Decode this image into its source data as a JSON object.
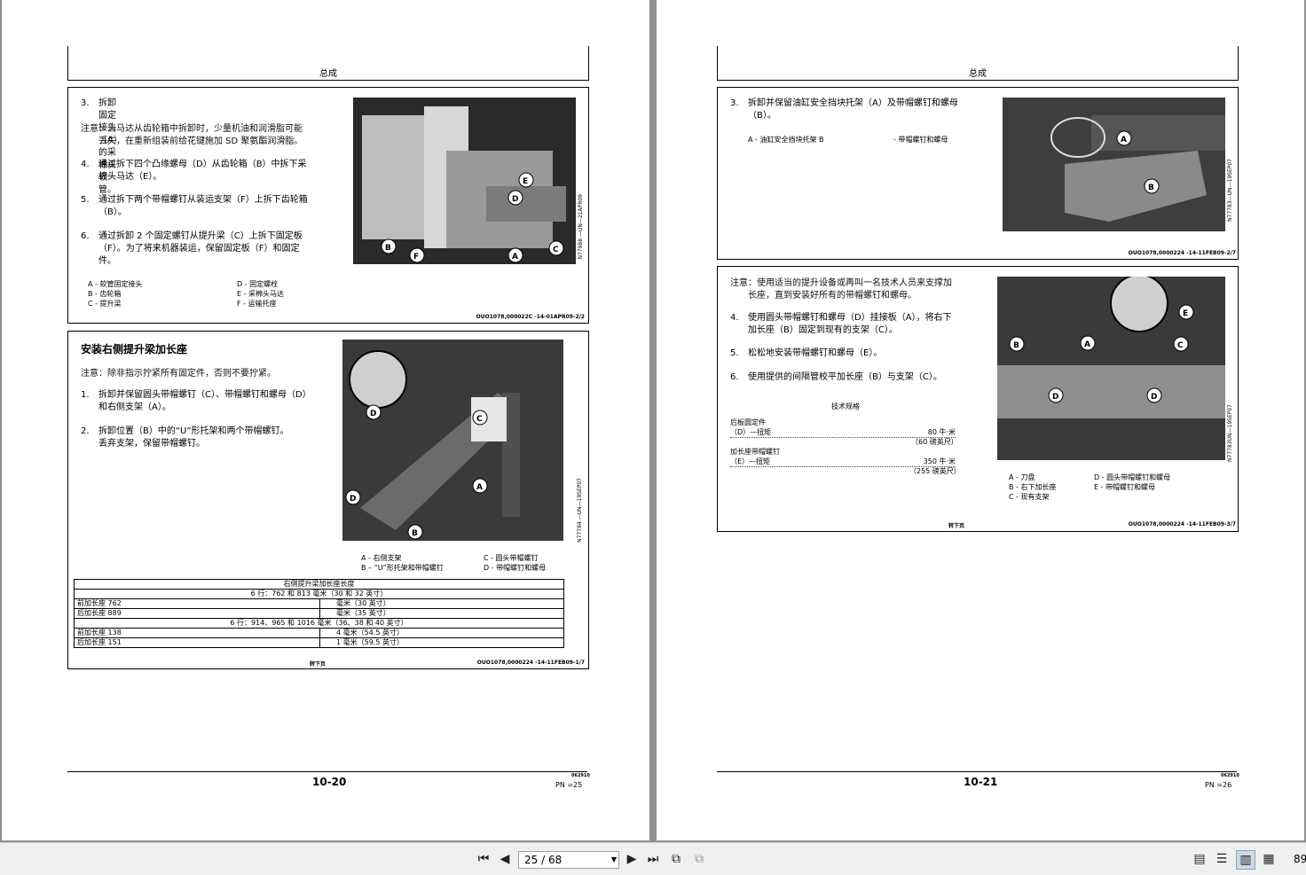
{
  "left_page": {
    "header": "总成",
    "section1": {
      "step3": {
        "num": "3.",
        "text": "拆卸固定接头（A）的采棉头软管。"
      },
      "note": [
        "注意：当马达从齿轮箱中拆卸时，少量机油和润滑脂可能",
        "丢失，在重新组装前给花键施加 SD 聚氨酯润滑脂。"
      ],
      "step4": {
        "num": "4.",
        "lines": [
          "通过拆下四个凸缘螺母（D）从齿轮箱（B）中拆下采",
          "棉头马达（E）。"
        ]
      },
      "step5": {
        "num": "5.",
        "lines": [
          "通过拆下两个带帽螺钉从装运支架（F）上拆下齿轮箱",
          "（B）。"
        ]
      },
      "step6": {
        "num": "6.",
        "lines": [
          "通过拆卸 2 个固定螺钉从提升梁（C）上拆下固定板",
          "（F）。为了将来机器装运，保留固定板（F）和固定",
          "件。"
        ]
      },
      "legend_left": [
        "A - 软管固定接头",
        "B - 齿轮箱",
        "C - 提升梁"
      ],
      "legend_right": [
        "D - 固定螺栓",
        "E - 采棉头马达",
        "F - 运输托座"
      ],
      "photo_code": "N77988 —UN—21APR09",
      "doc_id": "OUO1078,000022C -14-01APR09-2/2"
    },
    "section2": {
      "heading": "安装右侧提升梁加长座",
      "note": "注意：除非指示拧紧所有固定件，否则不要拧紧。",
      "step1": {
        "num": "1.",
        "lines": [
          "拆卸并保留圆头带帽螺钉（C）、带帽螺钉和螺母（D）",
          "和右侧支架（A）。"
        ]
      },
      "step2": {
        "num": "2.",
        "lines": [
          "拆卸位置（B）中的“U”形托架和两个带帽螺钉。",
          "丢弃支架，保留带帽螺钉。"
        ]
      },
      "legend_left": [
        "A - 右侧支架",
        "B – “U”形托架和带帽螺钉"
      ],
      "legend_right": [
        "C - 圆头带帽螺钉",
        "D - 带帽螺钉和螺母"
      ],
      "photo_code": "N77784 —UN—19SEP07",
      "table": {
        "title": "右侧提升梁加长座长度",
        "group1": "6 行：762 和 813 毫米（30 和 32 英寸）",
        "rows1": [
          [
            "前加长座 762",
            "毫米（30 英寸）"
          ],
          [
            "后加长座 889",
            "毫米（35 英寸）"
          ]
        ],
        "group2": "6 行：914、965 和 1016 毫米（36、38 和 40 英寸）",
        "rows2": [
          [
            "前加长座 138",
            "4 毫米（54.5 英寸）"
          ],
          [
            "后加长座 151",
            "1 毫米（59.5 英寸）"
          ]
        ]
      },
      "continued": "转下页",
      "doc_id": "OUO1078,0000224 -14-11FEB09-1/7"
    },
    "page_number": "10-20",
    "pn": "PN =25",
    "date_code": "062910"
  },
  "right_page": {
    "header": "总成",
    "section1": {
      "step3": {
        "num": "3.",
        "lines": [
          "拆卸并保留油缸安全挡块托架（A）及带帽螺钉和螺母",
          "（B）。"
        ]
      },
      "legend_left": "A - 油缸安全挡块托架 B",
      "legend_right": "- 带帽螺钉和螺母",
      "photo_code": "N77783—UN—19SEP07",
      "doc_id": "OUO1078,0000224 -14-11FEB09-2/7"
    },
    "section2": {
      "note": [
        "注意：使用适当的提升设备或再叫一名技术人员来支撑加",
        "长座，直到安装好所有的带帽螺钉和螺母。"
      ],
      "step4": {
        "num": "4.",
        "lines": [
          "使用圆头带帽螺钉和螺母（D）挂接板（A），将右下",
          "加长座（B）固定到现有的支架（C）。"
        ]
      },
      "step5": {
        "num": "5.",
        "text": "松松地安装带帽螺钉和螺母（E）。"
      },
      "step6": {
        "num": "6.",
        "text": "使用提供的间隔管校平加长座（B）与支架（C）。"
      },
      "spec_title": "技术规格",
      "spec1_label": "后板圆定件",
      "spec1_sub": "（D）—扭矩",
      "spec1_value": "80 牛·米",
      "spec1_alt": "（60 磅英尺）",
      "spec2_label": "加长座带帽螺钉",
      "spec2_sub": "（E）—扭矩",
      "spec2_value": "350 牛·米",
      "spec2_alt": "（255 磅英尺）",
      "legend_left": [
        "A - 刀盘",
        "B - 右下加长座",
        "C - 现有支架"
      ],
      "legend_right": [
        "D - 圆头带帽螺钉和螺母",
        "E - 带帽螺钉和螺母"
      ],
      "photo_code": "N77783UN—19SEP07",
      "continued": "转下页",
      "doc_id": "OUO1078,0000224 -14-11FEB09-3/7"
    },
    "page_number": "10-21",
    "pn": "PN =26",
    "date_code": "062910"
  },
  "toolbar": {
    "page_field": "25 / 68",
    "zoom": "89"
  }
}
